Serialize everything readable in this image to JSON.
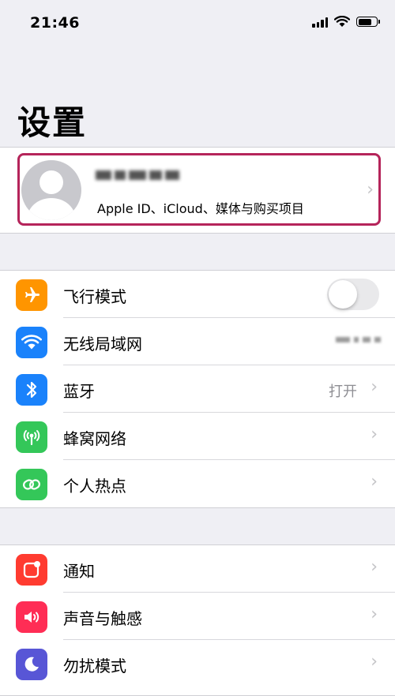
{
  "status_bar": {
    "time": "21:46",
    "battery_level": 0.8
  },
  "title": "设置",
  "profile": {
    "subtitle": "Apple ID、iCloud、媒体与购买项目"
  },
  "colors": {
    "airplane": "#ff9500",
    "wifi": "#1a82fb",
    "bluetooth": "#1a82fb",
    "cellular": "#34c759",
    "hotspot": "#34c759",
    "notifications": "#ff3b30",
    "sounds": "#ff2d55",
    "dnd": "#5856d6",
    "highlight": "#b5245a"
  },
  "groups": [
    {
      "items": [
        {
          "label": "飞行模式",
          "icon": "airplane-icon",
          "toggle_on": false
        },
        {
          "label": "无线局域网",
          "icon": "wifi-icon",
          "value": ""
        },
        {
          "label": "蓝牙",
          "icon": "bluetooth-icon",
          "value": "打开"
        },
        {
          "label": "蜂窝网络",
          "icon": "cellular-icon"
        },
        {
          "label": "个人热点",
          "icon": "hotspot-icon"
        }
      ]
    },
    {
      "items": [
        {
          "label": "通知",
          "icon": "notifications-icon"
        },
        {
          "label": "声音与触感",
          "icon": "sounds-icon"
        },
        {
          "label": "勿扰模式",
          "icon": "moon-icon"
        }
      ]
    }
  ]
}
